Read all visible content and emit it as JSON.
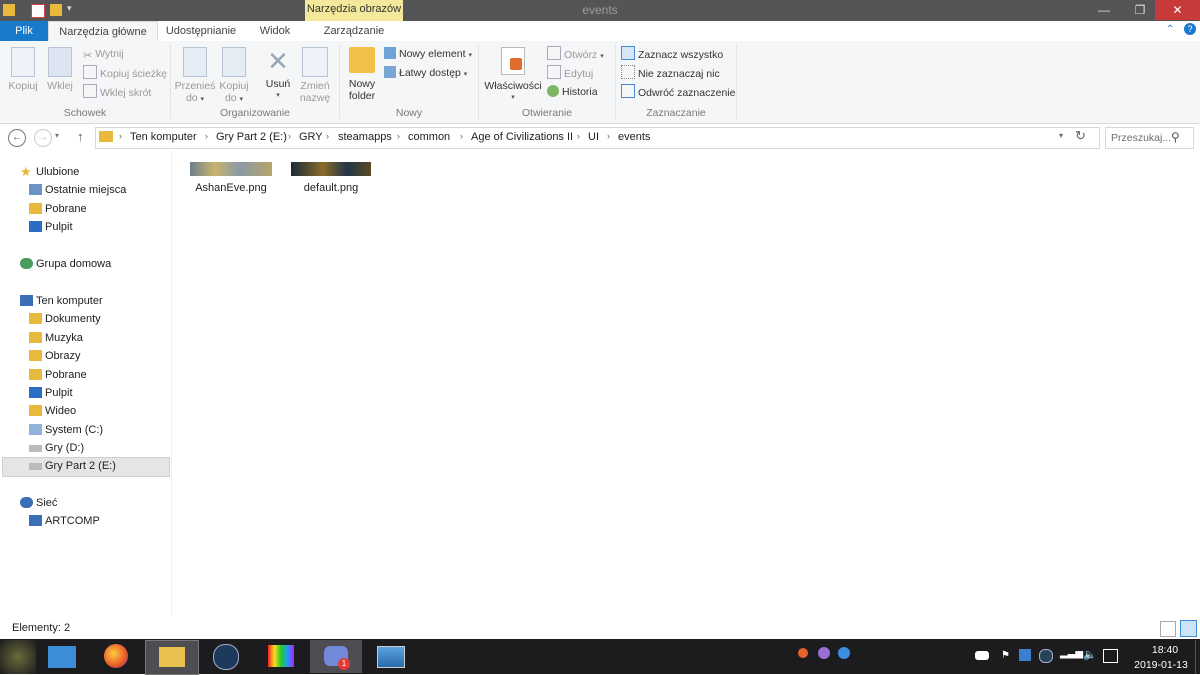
{
  "window": {
    "title": "events",
    "contextual_tab": "Narzędzia obrazów"
  },
  "tabs": {
    "file": "Plik",
    "home": "Narzędzia główne",
    "share": "Udostępnianie",
    "view": "Widok",
    "manage": "Zarządzanie"
  },
  "ribbon": {
    "clipboard": {
      "label": "Schowek",
      "copy": "Kopiuj",
      "paste": "Wklej",
      "cut": "Wytnij",
      "copy_path": "Kopiuj ścieżkę",
      "paste_shortcut": "Wklej skrót"
    },
    "organize": {
      "label": "Organizowanie",
      "move_to_1": "Przenieś",
      "move_to_2": "do",
      "copy_to_1": "Kopiuj",
      "copy_to_2": "do",
      "delete": "Usuń",
      "rename_1": "Zmień",
      "rename_2": "nazwę"
    },
    "new": {
      "label": "Nowy",
      "new_folder_1": "Nowy",
      "new_folder_2": "folder",
      "new_item": "Nowy element",
      "easy_access": "Łatwy dostęp"
    },
    "open": {
      "label": "Otwieranie",
      "properties": "Właściwości",
      "open": "Otwórz",
      "edit": "Edytuj",
      "history": "Historia"
    },
    "select": {
      "label": "Zaznaczanie",
      "select_all": "Zaznacz wszystko",
      "select_none": "Nie zaznaczaj nic",
      "invert": "Odwróć zaznaczenie"
    }
  },
  "address": {
    "crumbs": [
      "Ten komputer",
      "Gry Part 2 (E:)",
      "GRY",
      "steamapps",
      "common",
      "Age of Civilizations II",
      "UI",
      "events"
    ],
    "search_placeholder": "Przeszukaj..."
  },
  "nav": {
    "favorites": "Ulubione",
    "recent": "Ostatnie miejsca",
    "downloads_fav": "Pobrane",
    "desktop_fav": "Pulpit",
    "homegroup": "Grupa domowa",
    "computer": "Ten komputer",
    "documents": "Dokumenty",
    "music": "Muzyka",
    "pictures": "Obrazy",
    "downloads": "Pobrane",
    "desktop": "Pulpit",
    "videos": "Wideo",
    "drive_c": "System (C:)",
    "drive_d": "Gry (D:)",
    "drive_e": "Gry Part 2 (E:)",
    "network": "Sieć",
    "artcomp": "ARTCOMP"
  },
  "files": [
    {
      "name": "AshanEve.png"
    },
    {
      "name": "default.png"
    }
  ],
  "status": {
    "items": "Elementy: 2"
  },
  "taskbar": {
    "time": "18:40",
    "date": "2019-01-13",
    "discord_badge": "1"
  },
  "colors": {
    "file_tab": "#1979ca",
    "contextual_tab": "#f4e99a",
    "close_button": "#c83939",
    "taskbar": "#1c1c1f"
  }
}
